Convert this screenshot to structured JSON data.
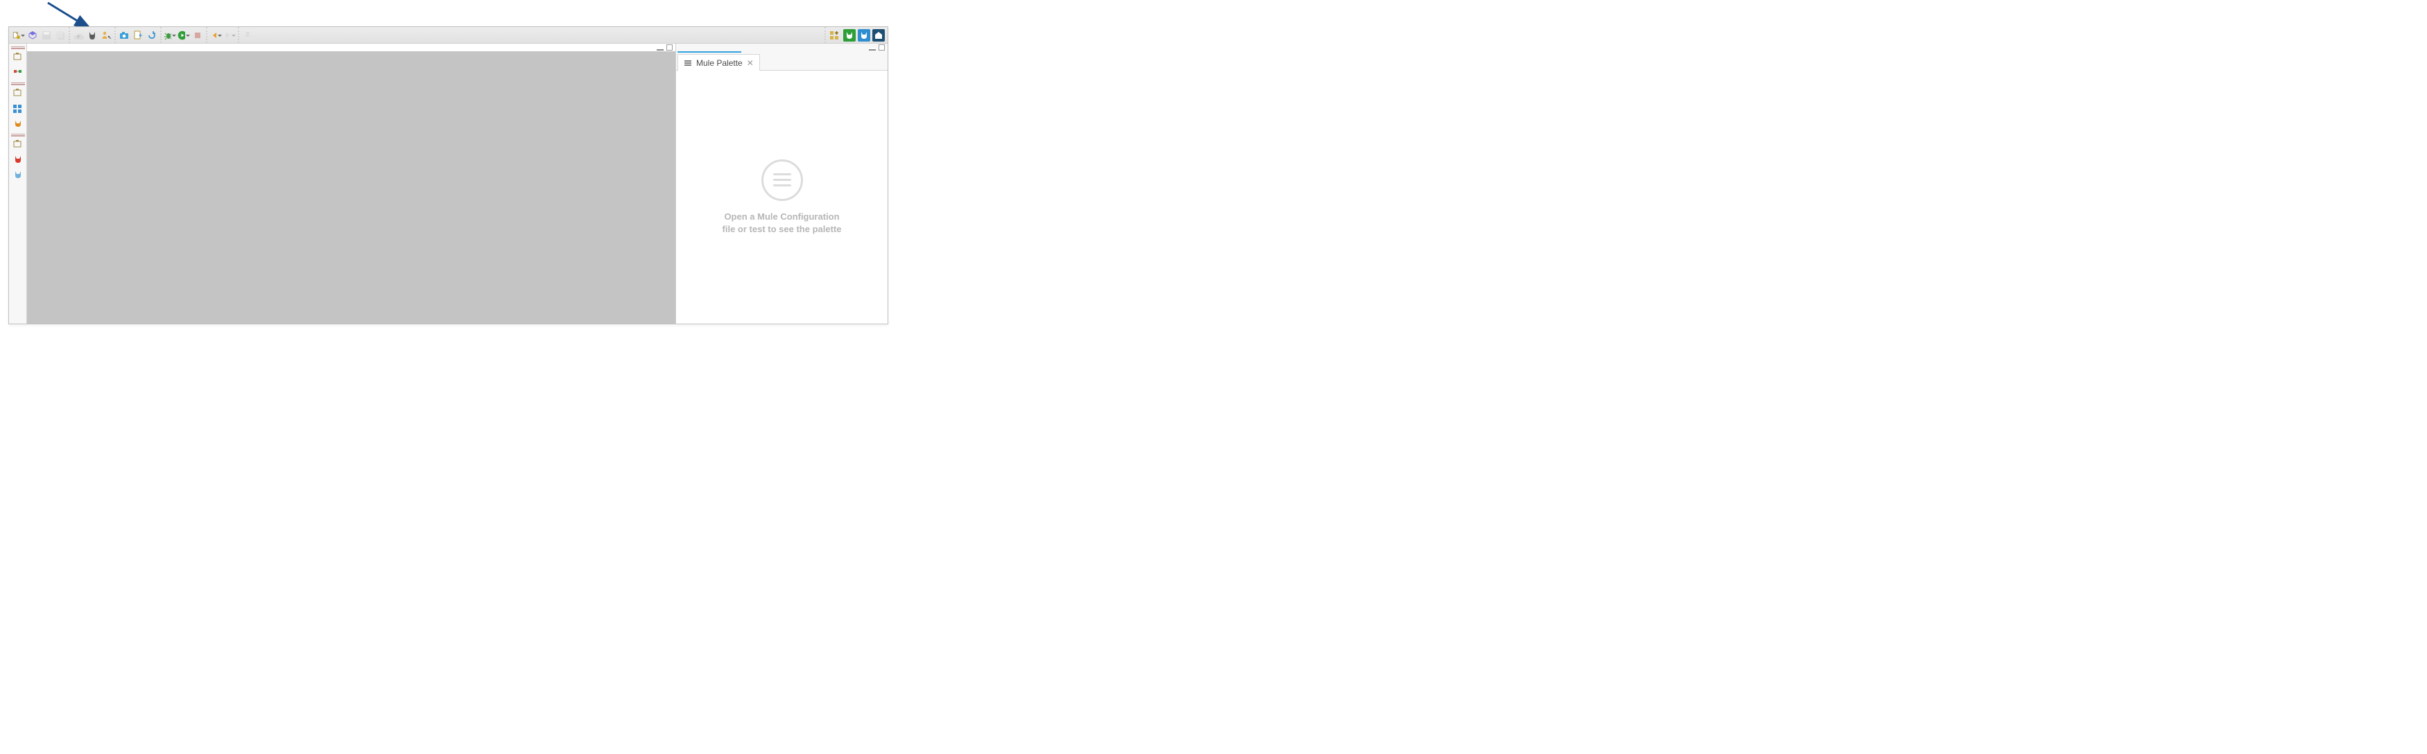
{
  "toolbar": {
    "new_wizard": "New",
    "exchange": "Open Exchange",
    "save": "Save",
    "save_all": "Save All",
    "publish": "Publish to Exchange",
    "deploy": "Deploy",
    "manage_api": "Manage API",
    "camera": "Export Diagram Image",
    "import": "Import",
    "refresh": "Refresh",
    "debug_cfg": "Debug",
    "run_cfg": "Run",
    "stop": "Terminate",
    "back": "Back",
    "forward": "Forward",
    "toggle": "Toggle"
  },
  "toolbar_right": {
    "perspective_open": "Open Perspective",
    "mule_design": "Mule Design",
    "mule_debug": "Mule Debug",
    "api_design": "API Design"
  },
  "activity_bar": {
    "item1": "Package Explorer",
    "item2": "Mule App",
    "item3": "Outline",
    "item4": "Global Elements",
    "item5": "Connections",
    "item6": "MUnit",
    "item7": "Mule Debug"
  },
  "palette": {
    "tab_label": "Mule Palette",
    "empty_line1": "Open a Mule Configuration",
    "empty_line2": "file or test to see the palette"
  },
  "annotation": {
    "target": "deploy-button"
  }
}
